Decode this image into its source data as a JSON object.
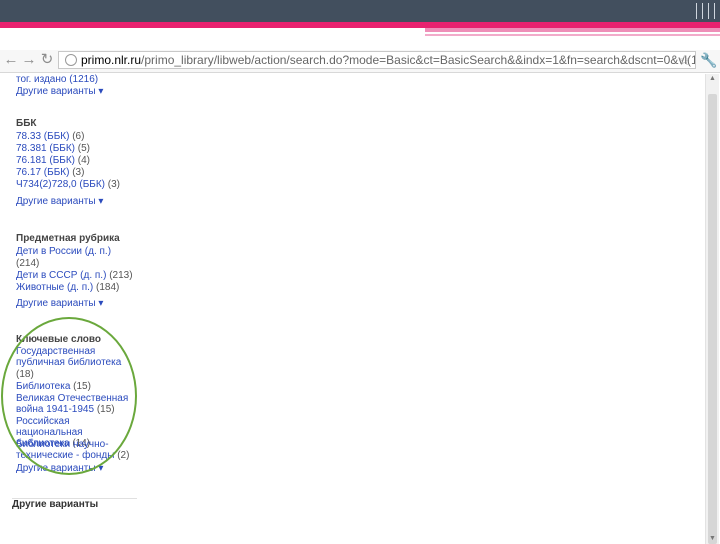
{
  "browser": {
    "url_host": "primo.nlr.ru",
    "url_path": "/primo_library/libweb/action/search.do?mode=Basic&ct=BasicSearch&&indx=1&fn=search&dscnt=0&vl(1",
    "star_icon": "star-icon",
    "wrench_icon": "wrench-icon"
  },
  "facets": {
    "top_partial": "тог. издано   (1216)",
    "more_label": "Другие варианты",
    "bbk": {
      "title": "ББК",
      "items": [
        {
          "label": "78.33 (ББК)",
          "count": "(6)"
        },
        {
          "label": "78.381 (ББК)",
          "count": "(5)"
        },
        {
          "label": "76.181 (ББК)",
          "count": "(4)"
        },
        {
          "label": "76.17 (ББК)",
          "count": "(3)"
        },
        {
          "label": "Ч734(2)728,0 (ББК)",
          "count": "(3)"
        }
      ]
    },
    "subject": {
      "title": "Предметная рубрика",
      "items": [
        {
          "label": "Дети в России (д. п.)",
          "count": "(214)"
        },
        {
          "label": "Дети в СССР (д. п.)",
          "count": "(213)"
        },
        {
          "label": "Животные (д. п.)",
          "count": "(184)"
        }
      ]
    },
    "keywords": {
      "title": "Ключевые слово",
      "items": [
        {
          "label": "Государственная публичная библиотека",
          "count": "(18)"
        },
        {
          "label": "Библиотека",
          "count": "(15)"
        },
        {
          "label": "Великая Отечественная война 1941-1945",
          "count": "(15)"
        },
        {
          "label": "Российская национальная библиотека",
          "count": "(14)"
        },
        {
          "label": "Библиотеки научно-технические - фонды",
          "count": "(2)"
        }
      ]
    },
    "bottom_panel": "Другие варианты"
  },
  "colors": {
    "slide_top": "#424f5e",
    "accent_pink": "#e8226f",
    "link_blue": "#2b4bbd",
    "circle_green": "#6aa83c"
  }
}
